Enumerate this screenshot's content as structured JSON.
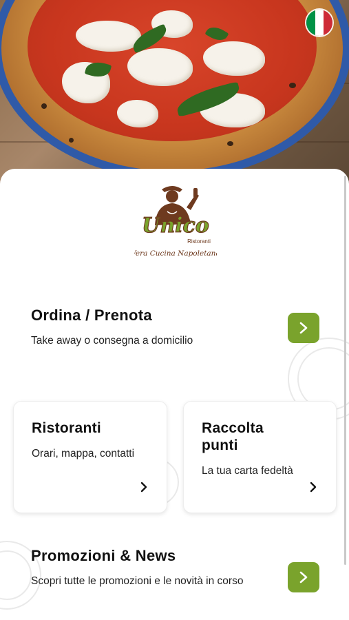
{
  "hero": {
    "image": "margherita-pizza-photo",
    "flag": "italian-flag-icon",
    "flag_colors": [
      "#009246",
      "#ffffff",
      "#ce2b37"
    ]
  },
  "logo": {
    "brand": "Unico",
    "tag": "Ristoranti",
    "tagline": "Vera Cucina Napoletana",
    "brand_color": "#6e3a1f",
    "accent_color": "#7aa32c"
  },
  "order": {
    "title": "Ordina / Prenota",
    "subtitle": "Take away o consegna a domicilio"
  },
  "restaurants": {
    "title": "Ristoranti",
    "subtitle": "Orari, mappa, contatti"
  },
  "points": {
    "title_line1": "Raccolta",
    "title_line2": "punti",
    "subtitle": "La tua carta fedeltà"
  },
  "promos": {
    "title": "Promozioni & News",
    "subtitle": "Scopri tutte le promozioni e le novità in corso"
  },
  "colors": {
    "button": "#7aa32c",
    "text": "#111111"
  }
}
